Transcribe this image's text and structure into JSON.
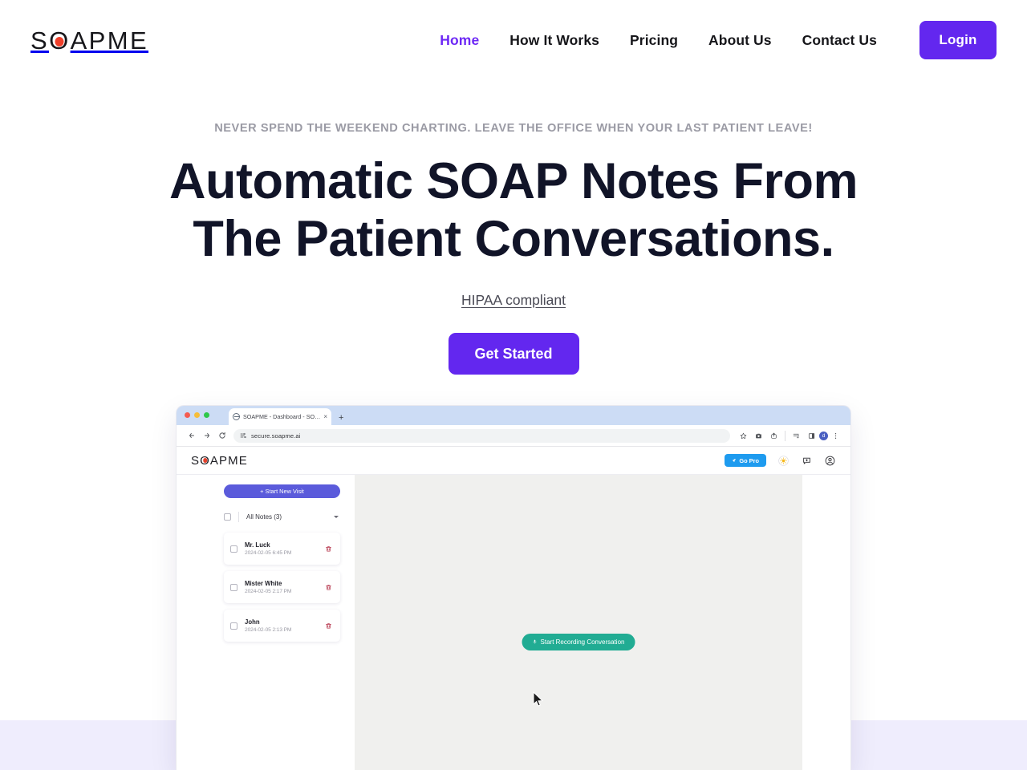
{
  "brand": {
    "name": "SOAPME",
    "logo_prefix": "S",
    "logo_o": "O",
    "logo_suffix": "APME",
    "dot_color": "#f0402b",
    "accent_color": "#6327ef"
  },
  "nav": {
    "items": [
      {
        "label": "Home",
        "active": true
      },
      {
        "label": "How It Works",
        "active": false
      },
      {
        "label": "Pricing",
        "active": false
      },
      {
        "label": "About Us",
        "active": false
      },
      {
        "label": "Contact Us",
        "active": false
      }
    ],
    "login_label": "Login"
  },
  "hero": {
    "eyebrow": "NEVER SPEND THE WEEKEND CHARTING. LEAVE THE OFFICE WHEN YOUR LAST PATIENT LEAVE!",
    "headline": "Automatic SOAP Notes From The Patient Conversations.",
    "hipaa_label": "HIPAA compliant",
    "cta_label": "Get Started"
  },
  "browser": {
    "tab_title": "SOAPME - Dashboard - SOA…",
    "tab_close_glyph": "×",
    "new_tab_glyph": "+",
    "url": "secure.soapme.ai",
    "avatar_initial": "d",
    "icons": {
      "back": "back-arrow-icon",
      "forward": "forward-arrow-icon",
      "reload": "reload-icon",
      "site_info": "site-settings-icon",
      "bookmark": "star-icon",
      "camera": "camera-icon",
      "share": "share-icon",
      "extensions": "extensions-icon",
      "sidebar": "sidebar-panel-icon",
      "menu": "three-dot-menu-icon"
    }
  },
  "app": {
    "logo_prefix": "S",
    "logo_o": "O",
    "logo_suffix": "APME",
    "gopro_label": "Go Pro",
    "gopro_color": "#1e9bef",
    "header_icons": {
      "theme": "sun-icon",
      "feedback": "feedback-icon",
      "account": "account-circle-icon"
    },
    "sidebar": {
      "new_visit_label": "+ Start New Visit",
      "new_visit_color": "#5b5bdb",
      "filter_label": "All Notes (3)",
      "notes": [
        {
          "name": "Mr. Luck",
          "time": "2024-02-05 6:45 PM"
        },
        {
          "name": "Mister White",
          "time": "2024-02-05 2:17 PM"
        },
        {
          "name": "John",
          "time": "2024-02-05 2:13 PM"
        }
      ]
    },
    "canvas": {
      "record_label": "Start Recording Conversation",
      "record_color": "#21ac93",
      "mic_glyph": "ᵜ"
    }
  }
}
